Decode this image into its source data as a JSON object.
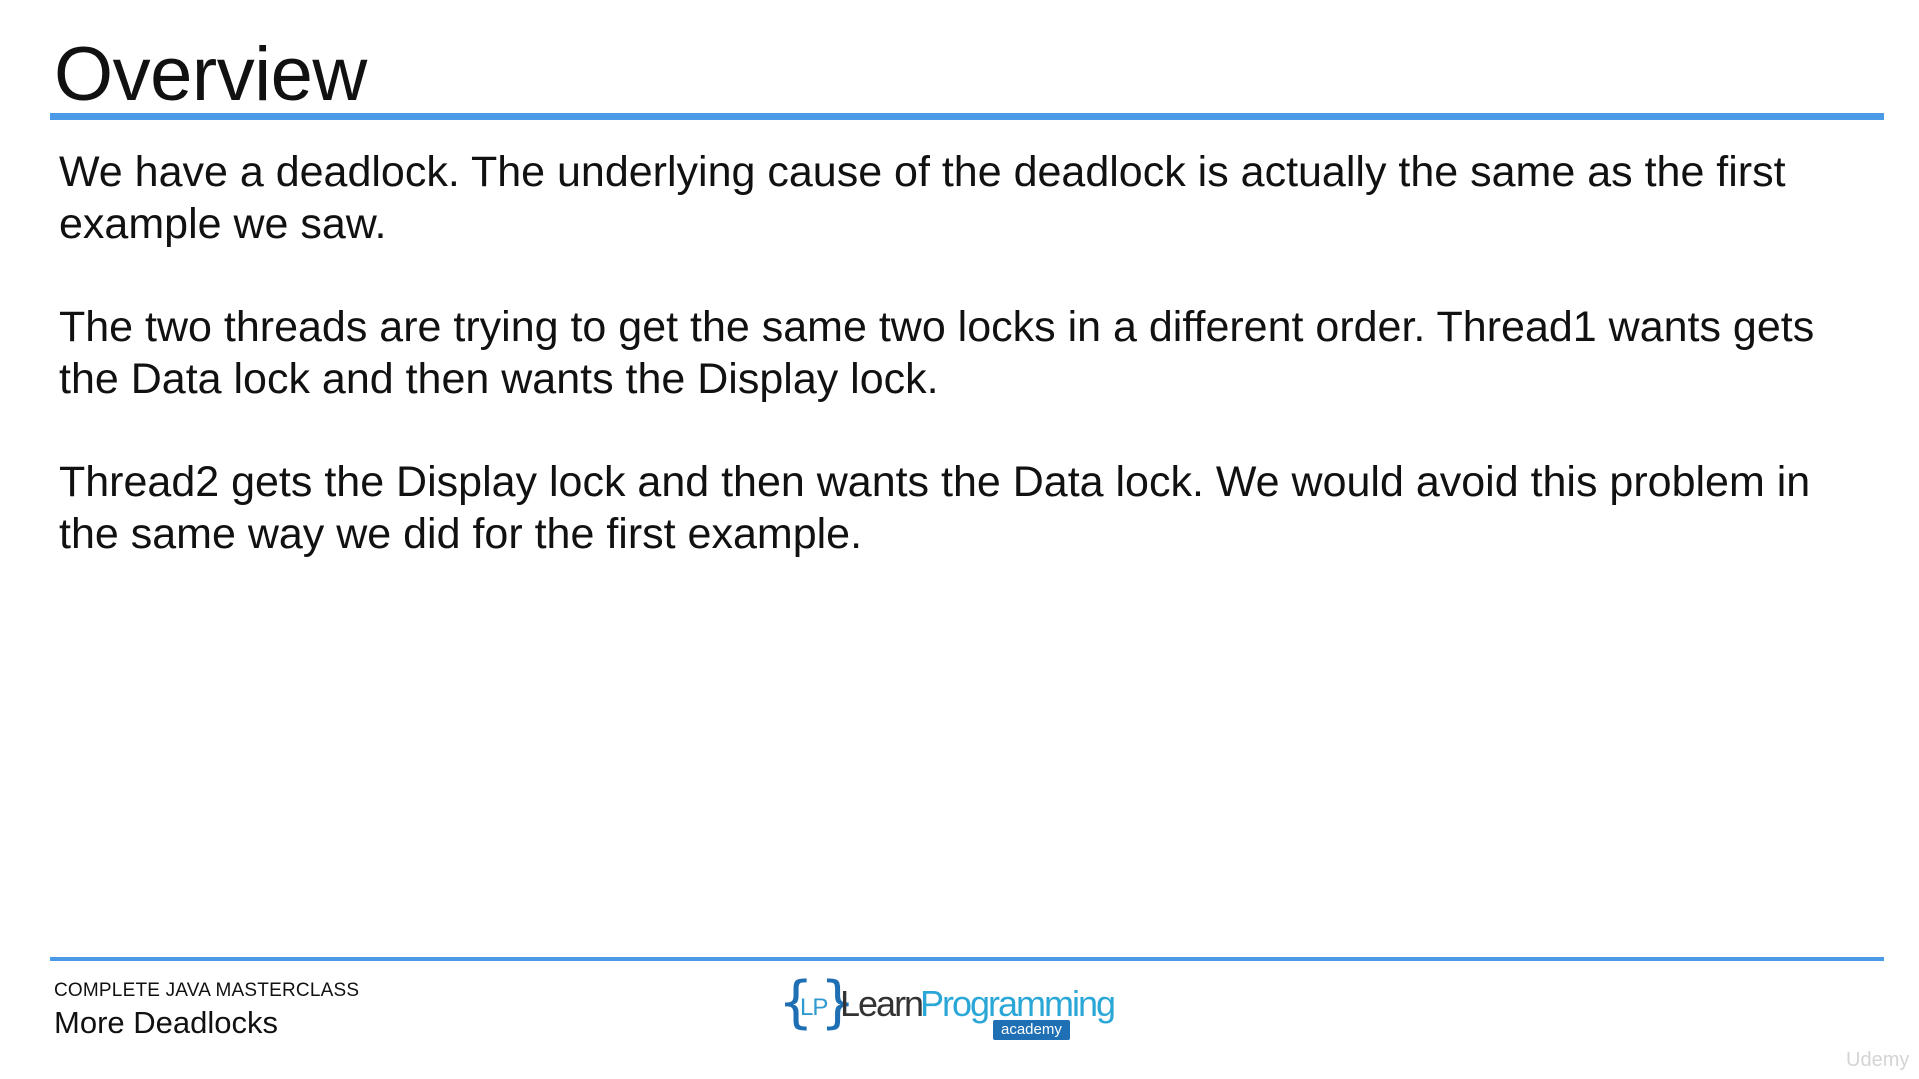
{
  "slide": {
    "title": "Overview",
    "paragraphs": [
      "We have a deadlock. The underlying cause of the deadlock is actually the same as the first example we saw.",
      "The two threads are trying to get the same two locks in a different order. Thread1 wants gets the Data lock and then wants the Display lock.",
      "Thread2 gets the Display lock and then wants the Data lock. We would avoid this problem in the same way we did for the first example."
    ]
  },
  "footer": {
    "course": "COMPLETE JAVA MASTERCLASS",
    "lecture": "More Deadlocks"
  },
  "logo": {
    "brace_open": "{",
    "monogram": "LP",
    "brace_close": "}",
    "learn": "Learn",
    "programming": "Programming",
    "academy": "academy"
  },
  "watermark": "Udemy",
  "colors": {
    "accent_rule": "#4a9ae8",
    "logo_blue": "#1f6fb5",
    "logo_cyan": "#2aa7d6",
    "text": "#111111"
  }
}
